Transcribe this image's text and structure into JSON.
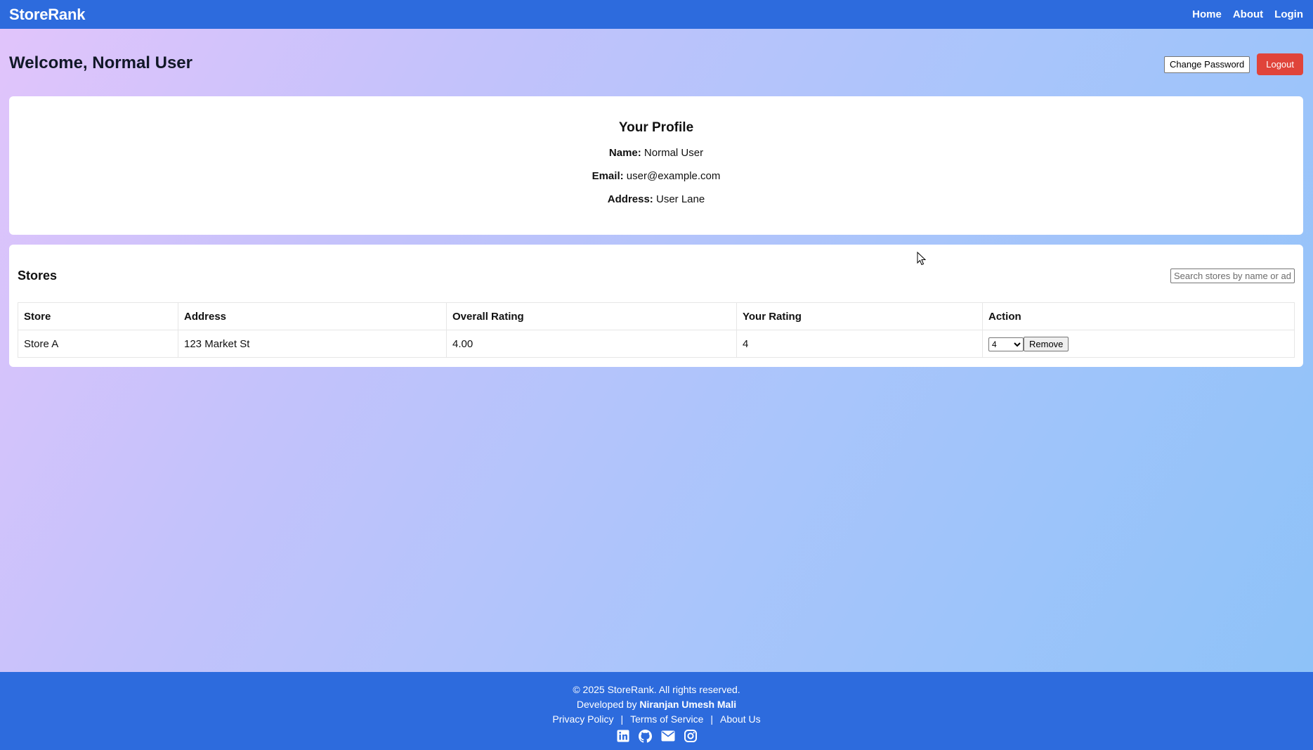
{
  "navbar": {
    "brand": "StoreRank",
    "links": [
      "Home",
      "About",
      "Login"
    ]
  },
  "header": {
    "welcome": "Welcome, Normal User",
    "change_password_label": "Change Password",
    "logout_label": "Logout"
  },
  "profile": {
    "title": "Your Profile",
    "name_label": "Name:",
    "name_value": "Normal User",
    "email_label": "Email:",
    "email_value": "user@example.com",
    "address_label": "Address:",
    "address_value": "User Lane"
  },
  "stores": {
    "title": "Stores",
    "search_placeholder": "Search stores by name or address",
    "columns": [
      "Store",
      "Address",
      "Overall Rating",
      "Your Rating",
      "Action"
    ],
    "rows": [
      {
        "store": "Store A",
        "address": "123 Market St",
        "overall_rating": "4.00",
        "your_rating": "4",
        "selected_rating": "4",
        "remove_label": "Remove"
      }
    ]
  },
  "footer": {
    "copyright": "© 2025 StoreRank. All rights reserved.",
    "developed_prefix": "Developed by",
    "developer": "Niranjan Umesh Mali",
    "links": [
      "Privacy Policy",
      "Terms of Service",
      "About Us"
    ],
    "icons": [
      "linkedin-icon",
      "github-icon",
      "email-icon",
      "instagram-icon"
    ]
  },
  "colors": {
    "primary": "#2d6bdd",
    "logout": "#e0443a"
  }
}
